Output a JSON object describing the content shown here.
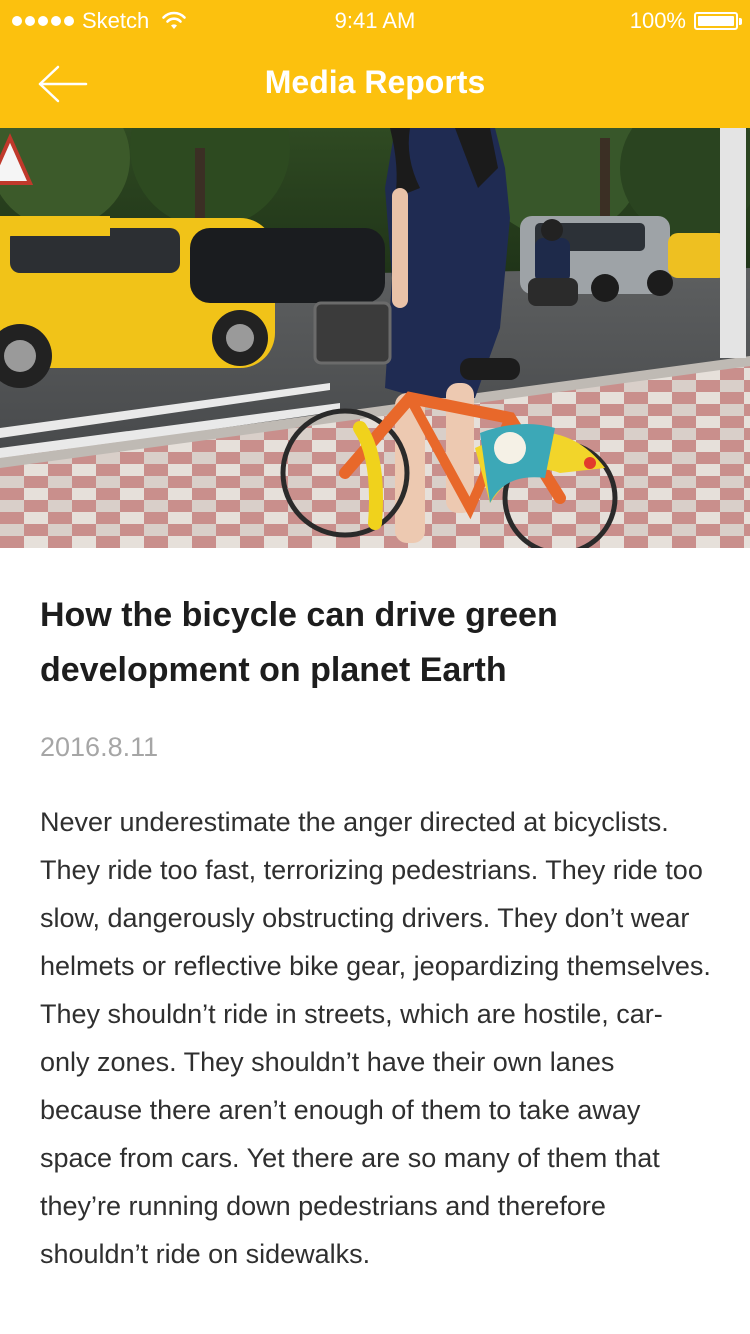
{
  "status_bar": {
    "carrier": "Sketch",
    "time": "9:41 AM",
    "battery": "100%"
  },
  "nav": {
    "back_icon": "arrow-left-icon",
    "title": "Media Reports"
  },
  "hero": {
    "image": "photo of a woman in a navy dress standing with an orange rental bicycle on a city sidewalk beside traffic with a yellow taxi"
  },
  "article": {
    "title": "How the bicycle can drive green development on planet Earth",
    "date": "2016.8.11",
    "body": "Never underestimate the anger directed at bicyclists. They ride too fast, terrorizing pedestrians. They ride too slow, dangerously obstructing drivers. They don’t wear helmets or reflective bike gear, jeopardizing themselves. They shouldn’t ride in streets, which are hostile, car-only zones. They shouldn’t have their own lanes because there aren’t enough of them to take away space from cars. Yet there are so many of them that they’re running down pedestrians and therefore shouldn’t ride on sidewalks."
  },
  "colors": {
    "accent": "#fcc10e",
    "date_text": "#a6a6a6"
  }
}
